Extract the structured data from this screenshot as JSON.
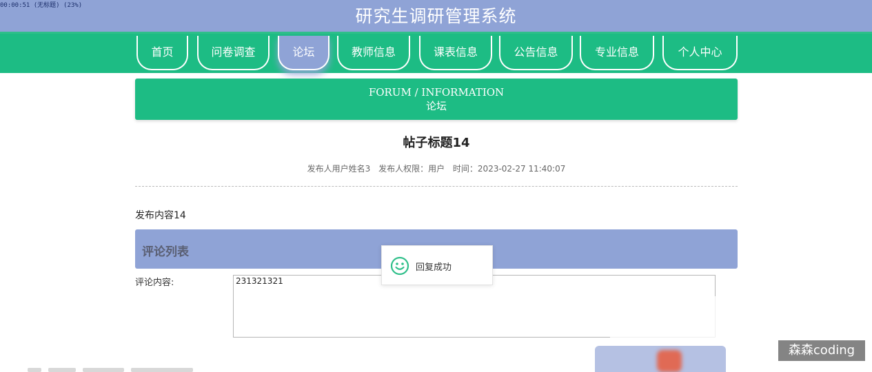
{
  "recording_label": "00:00:51 (无标题) (23%)",
  "site": {
    "title": "研究生调研管理系统"
  },
  "nav": {
    "items": [
      {
        "label": "首页",
        "active": false
      },
      {
        "label": "问卷调查",
        "active": false
      },
      {
        "label": "论坛",
        "active": true
      },
      {
        "label": "教师信息",
        "active": false
      },
      {
        "label": "课表信息",
        "active": false
      },
      {
        "label": "公告信息",
        "active": false
      },
      {
        "label": "专业信息",
        "active": false
      },
      {
        "label": "个人中心",
        "active": false
      }
    ]
  },
  "banner": {
    "en": "FORUM / INFORMATION",
    "cn": "论坛"
  },
  "post": {
    "title": "帖子标题14",
    "author": "发布人用户姓名3",
    "role": "发布人权限：用户",
    "time": "时间：2023-02-27 11:40:07",
    "content": "发布内容14"
  },
  "comments": {
    "title": "评论列表",
    "label": "评论内容:",
    "value": "231321321"
  },
  "toast": {
    "icon": "smile-icon",
    "message": "回复成功"
  },
  "watermark": "森森coding",
  "colors": {
    "header": "#8fa3d6",
    "nav": "#1dbc84",
    "active_tab": "#8fa3d6"
  }
}
